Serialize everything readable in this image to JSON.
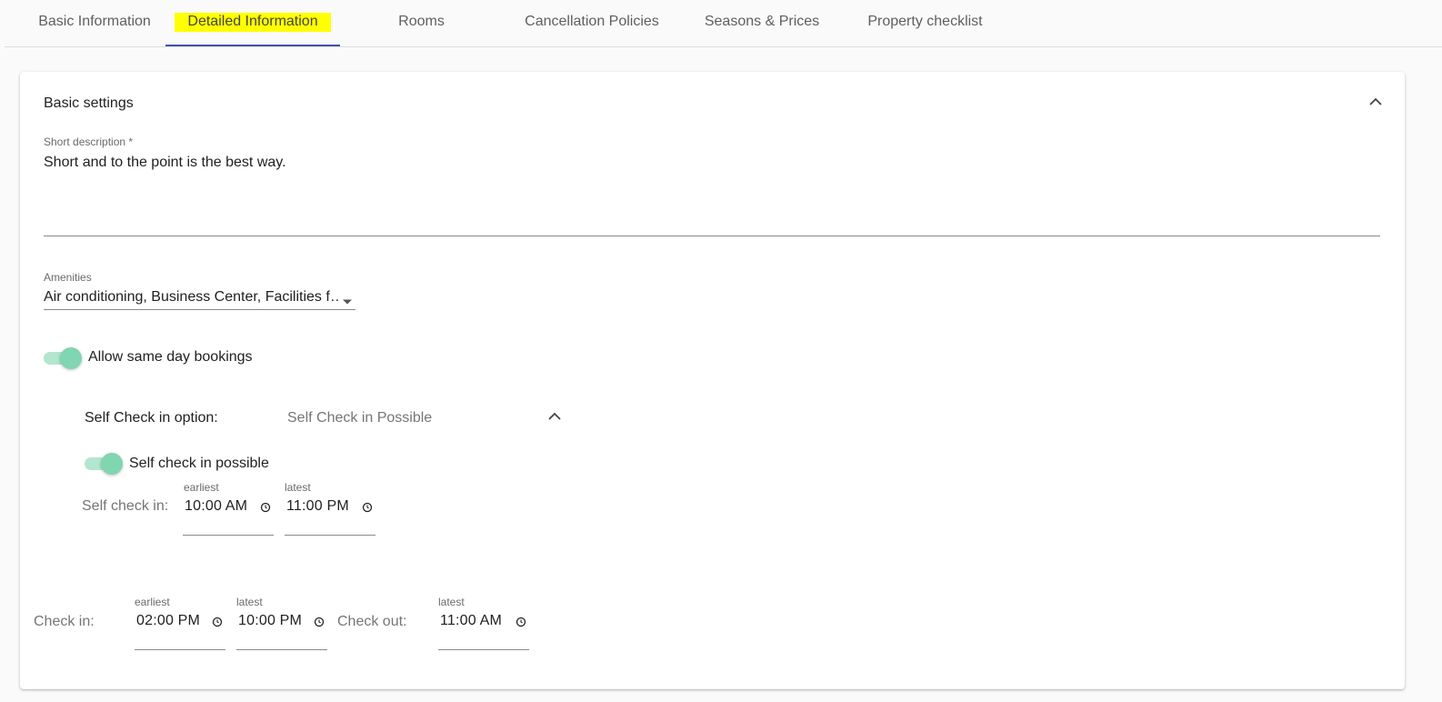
{
  "tabs": [
    {
      "label": "Basic Information",
      "active": false
    },
    {
      "label": "Detailed Information",
      "active": true
    },
    {
      "label": "Rooms",
      "active": false
    },
    {
      "label": "Cancellation Policies",
      "active": false
    },
    {
      "label": "Seasons & Prices",
      "active": false
    },
    {
      "label": "Property checklist",
      "active": false
    }
  ],
  "colors": {
    "active_tab_highlight": "#ffff00",
    "active_tab_underline": "#3f51b5",
    "toggle_track": "#b3e6cf",
    "toggle_thumb": "#7fd6b0"
  },
  "basic_settings": {
    "title": "Basic settings",
    "collapse_icon": "chevron-up-icon",
    "short_description": {
      "label": "Short description *",
      "value": "Short and to the point is the best way."
    },
    "amenities": {
      "label": "Amenities",
      "value": "Air conditioning, Business Center, Facilities f…",
      "icon": "dropdown-arrow-icon"
    },
    "same_day": {
      "label": "Allow same day bookings",
      "checked": true
    },
    "self_check_in": {
      "option_label": "Self Check in option:",
      "option_value": "Self Check in Possible",
      "toggle_label": "Self check in possible",
      "checked": true,
      "row_label": "Self check in:",
      "earliest_label": "earliest",
      "earliest_value": "10:00 AM",
      "latest_label": "latest",
      "latest_value": "11:00 PM"
    },
    "check_in": {
      "label": "Check in:",
      "earliest_label": "earliest",
      "earliest_value": "02:00 PM",
      "latest_label": "latest",
      "latest_value": "10:00 PM"
    },
    "check_out": {
      "label": "Check out:",
      "latest_label": "latest",
      "latest_value": "11:00 AM"
    }
  }
}
